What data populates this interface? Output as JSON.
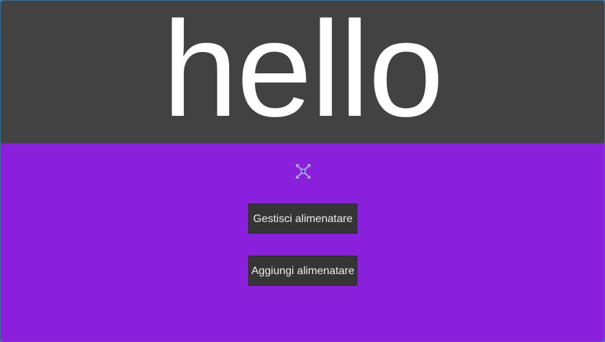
{
  "header": {
    "title": "hello",
    "background": "#424242",
    "text_color": "#ffffff"
  },
  "main": {
    "background": "#8a1fdc",
    "center_icon": "move-gizmo-icon",
    "buttons": [
      {
        "label": "Gestisci alimenatare"
      },
      {
        "label": "Aggiungi alimenatare"
      }
    ],
    "button_color": "#353535"
  }
}
